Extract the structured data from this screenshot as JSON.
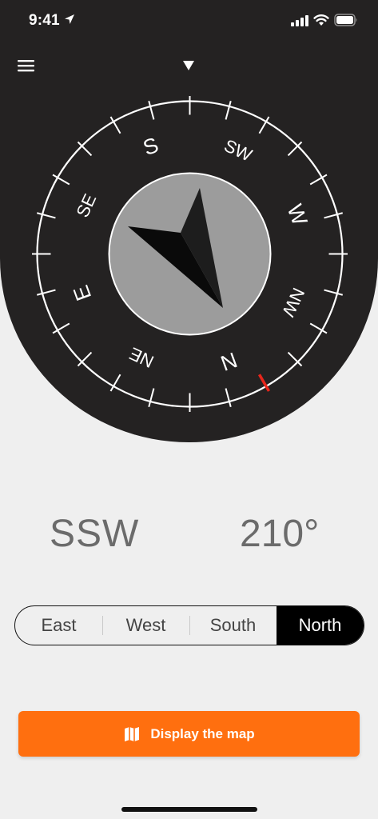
{
  "status_bar": {
    "time": "9:41"
  },
  "compass": {
    "labels": [
      {
        "text": "N",
        "angle": 0
      },
      {
        "text": "NE",
        "angle": 45
      },
      {
        "text": "E",
        "angle": 90
      },
      {
        "text": "SE",
        "angle": 135
      },
      {
        "text": "S",
        "angle": 180
      },
      {
        "text": "SW",
        "angle": 225
      },
      {
        "text": "W",
        "angle": 270
      },
      {
        "text": "NW",
        "angle": 315
      }
    ],
    "heading_degrees": 210,
    "north_marker_color": "#e8261b"
  },
  "readout": {
    "direction": "SSW",
    "degrees": "210°"
  },
  "segments": {
    "items": [
      "East",
      "West",
      "South",
      "North"
    ],
    "selected": "North"
  },
  "map_button": {
    "label": "Display the map",
    "color": "#ff6f0f"
  },
  "icons": {
    "menu": "hamburger-menu-icon",
    "pointer": "triangle-down-icon",
    "map": "folded-map-icon",
    "location": "location-arrow-icon"
  }
}
